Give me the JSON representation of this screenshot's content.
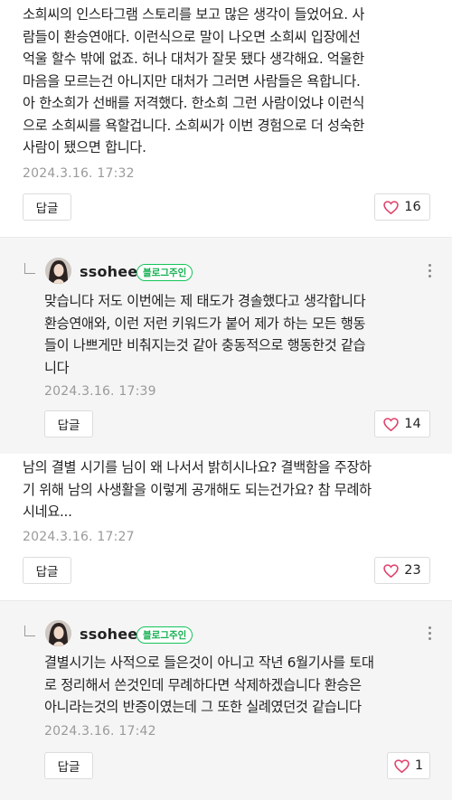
{
  "colors": {
    "heart": "#e0426b",
    "badge": "#12b04f",
    "reply_background": "#f5f5f5"
  },
  "comments": [
    {
      "type": "comment",
      "text": "소희씨의 인스타그램 스토리를 보고 많은 생각이 들었어요. 사\n람들이 환승연애다. 이런식으로 말이 나오면 소희씨 입장에선\n억울 할수 밖에 없죠. 허나 대처가 잘못 됐다 생각해요. 억울한\n마음을 모르는건 아니지만 대처가 그러면 사람들은 욕합니다.\n아 한소희가 선배를 저격했다. 한소희 그런 사람이었냐 이런식\n으로 소희씨를 욕할겁니다. 소희씨가 이번 경험으로 더 성숙한\n사람이 됐으면 합니다.",
      "date": "2024.3.16. 17:32",
      "reply_label": "답글",
      "likes": "16"
    },
    {
      "type": "reply",
      "author": "ssohee",
      "badge": "블로그주인",
      "text": "맞습니다 저도 이번에는 제 태도가 경솔했다고 생각합니다\n환승연애와, 이런 저런 키워드가 붙어 제가 하는 모든 행동\n들이 나쁘게만 비춰지는것 같아 충동적으로 행동한것 같습\n니다",
      "date": "2024.3.16. 17:39",
      "reply_label": "답글",
      "likes": "14"
    },
    {
      "type": "comment",
      "text": "남의 결별 시기를 님이 왜 나서서 밝히시나요? 결백함을 주장하\n기 위해 남의 사생활을 이렇게 공개해도 되는건가요? 참 무례하\n시네요...",
      "date": "2024.3.16. 17:27",
      "reply_label": "답글",
      "likes": "23"
    },
    {
      "type": "reply",
      "author": "ssohee",
      "badge": "블로그주인",
      "text": "결별시기는 사적으로 들은것이 아니고 작년 6월기사를 토대\n로 정리해서 쓴것인데 무례하다면 삭제하겠습니다 환승은\n아니라는것의 반증이였는데 그 또한 실례였던것 같습니다",
      "date": "2024.3.16. 17:42",
      "reply_label": "답글",
      "likes": "1"
    }
  ]
}
